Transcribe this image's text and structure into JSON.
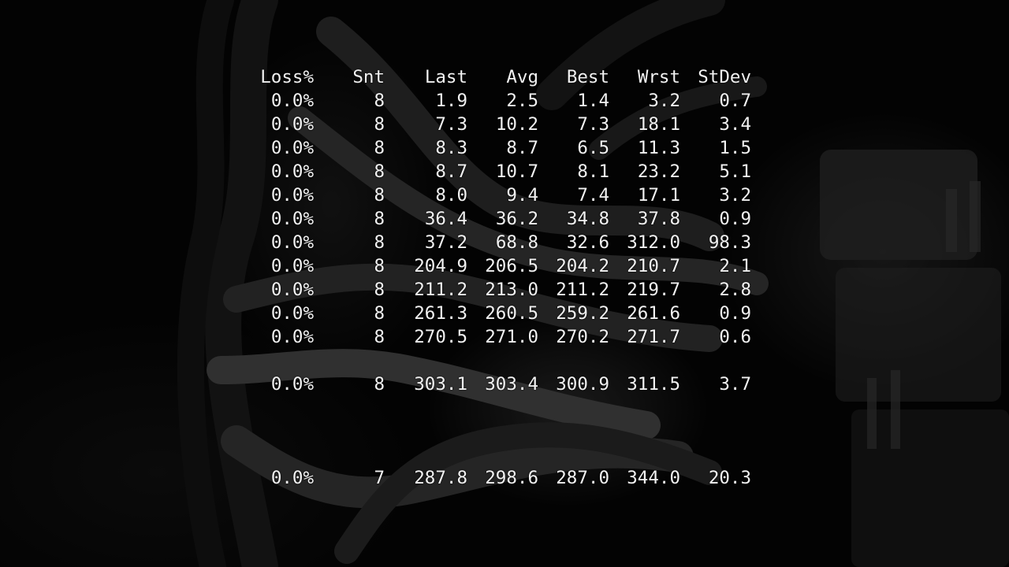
{
  "table": {
    "headers": [
      "Loss%",
      "Snt",
      "Last",
      "Avg",
      "Best",
      "Wrst",
      "StDev"
    ],
    "rows": [
      [
        "0.0%",
        "8",
        "1.9",
        "2.5",
        "1.4",
        "3.2",
        "0.7"
      ],
      [
        "0.0%",
        "8",
        "7.3",
        "10.2",
        "7.3",
        "18.1",
        "3.4"
      ],
      [
        "0.0%",
        "8",
        "8.3",
        "8.7",
        "6.5",
        "11.3",
        "1.5"
      ],
      [
        "0.0%",
        "8",
        "8.7",
        "10.7",
        "8.1",
        "23.2",
        "5.1"
      ],
      [
        "0.0%",
        "8",
        "8.0",
        "9.4",
        "7.4",
        "17.1",
        "3.2"
      ],
      [
        "0.0%",
        "8",
        "36.4",
        "36.2",
        "34.8",
        "37.8",
        "0.9"
      ],
      [
        "0.0%",
        "8",
        "37.2",
        "68.8",
        "32.6",
        "312.0",
        "98.3"
      ],
      [
        "0.0%",
        "8",
        "204.9",
        "206.5",
        "204.2",
        "210.7",
        "2.1"
      ],
      [
        "0.0%",
        "8",
        "211.2",
        "213.0",
        "211.2",
        "219.7",
        "2.8"
      ],
      [
        "0.0%",
        "8",
        "261.3",
        "260.5",
        "259.2",
        "261.6",
        "0.9"
      ],
      [
        "0.0%",
        "8",
        "270.5",
        "271.0",
        "270.2",
        "271.7",
        "0.6"
      ],
      [
        "0.0%",
        "8",
        "303.1",
        "303.4",
        "300.9",
        "311.5",
        "3.7"
      ],
      [
        "0.0%",
        "7",
        "287.8",
        "298.6",
        "287.0",
        "344.0",
        "20.3"
      ]
    ]
  },
  "colors": {
    "text": "#f2f2f2",
    "background": "#050505"
  }
}
